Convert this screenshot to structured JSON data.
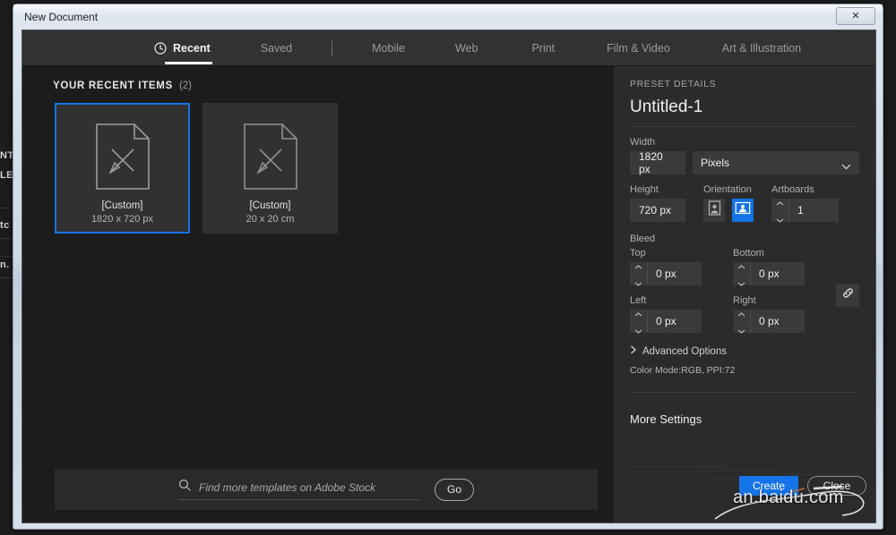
{
  "window": {
    "title": "New Document",
    "close_label": "✕"
  },
  "tabs": [
    {
      "label": "Recent",
      "icon": "clock-icon",
      "active": true
    },
    {
      "label": "Saved",
      "icon": "",
      "active": false
    },
    {
      "label": "Mobile",
      "icon": "",
      "active": false
    },
    {
      "label": "Web",
      "icon": "",
      "active": false
    },
    {
      "label": "Print",
      "icon": "",
      "active": false
    },
    {
      "label": "Film & Video",
      "icon": "",
      "active": false
    },
    {
      "label": "Art & Illustration",
      "icon": "",
      "active": false
    }
  ],
  "recent": {
    "heading": "YOUR RECENT ITEMS",
    "count": "(2)",
    "items": [
      {
        "name": "[Custom]",
        "size": "1820 x 720 px",
        "selected": true
      },
      {
        "name": "[Custom]",
        "size": "20 x 20 cm",
        "selected": false
      }
    ]
  },
  "stock": {
    "placeholder": "Find more templates on Adobe Stock",
    "value": "",
    "go_label": "Go"
  },
  "preset": {
    "section_label": "PRESET DETAILS",
    "name": "Untitled-1",
    "width_label": "Width",
    "width_value": "1820 px",
    "units_value": "Pixels",
    "height_label": "Height",
    "height_value": "720 px",
    "orientation_label": "Orientation",
    "orientation_selected": "landscape",
    "artboards_label": "Artboards",
    "artboards_value": "1",
    "bleed_label": "Bleed",
    "bleed_top_label": "Top",
    "bleed_top_value": "0 px",
    "bleed_bottom_label": "Bottom",
    "bleed_bottom_value": "0 px",
    "bleed_left_label": "Left",
    "bleed_left_value": "0 px",
    "bleed_right_label": "Right",
    "bleed_right_value": "0 px",
    "advanced_options_label": "Advanced Options",
    "color_mode_text": "Color Mode:RGB, PPI:72",
    "more_settings_label": "More Settings"
  },
  "actions": {
    "create_label": "Create",
    "close_label": "Close"
  },
  "watermark": {
    "text": "an.baidu.com"
  },
  "background_app": {
    "fragments": [
      "NT",
      "LE",
      "tc",
      "n."
    ]
  },
  "colors": {
    "accent": "#1473e6",
    "panel_bg": "#2b2b2b",
    "content_bg": "#1c1c1c",
    "tabbar_bg": "#323232",
    "titlebar_text": "#20242b"
  }
}
